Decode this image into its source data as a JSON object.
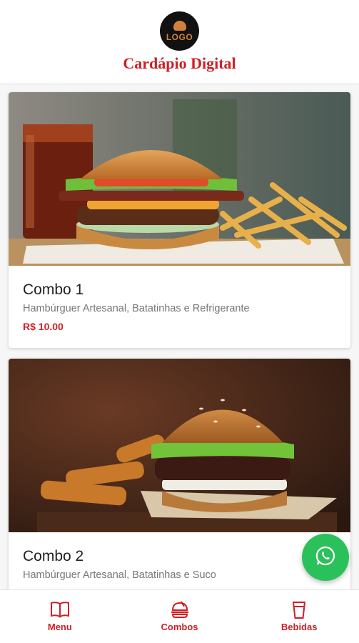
{
  "header": {
    "logo_text": "LOGO",
    "title": "Cardápio Digital"
  },
  "items": [
    {
      "name": "Combo 1",
      "description": "Hambúrguer Artesanal, Batatinhas e Refrigerante",
      "price": "R$ 10.00"
    },
    {
      "name": "Combo 2",
      "description": "Hambúrguer Artesanal, Batatinhas e Suco"
    }
  ],
  "nav": [
    {
      "label": "Menu",
      "icon": "book-icon"
    },
    {
      "label": "Combos",
      "icon": "burger-icon"
    },
    {
      "label": "Bebidas",
      "icon": "cup-icon"
    }
  ],
  "colors": {
    "accent": "#cf1f25",
    "whatsapp": "#2bc15a",
    "logo_gold": "#d2813a"
  }
}
